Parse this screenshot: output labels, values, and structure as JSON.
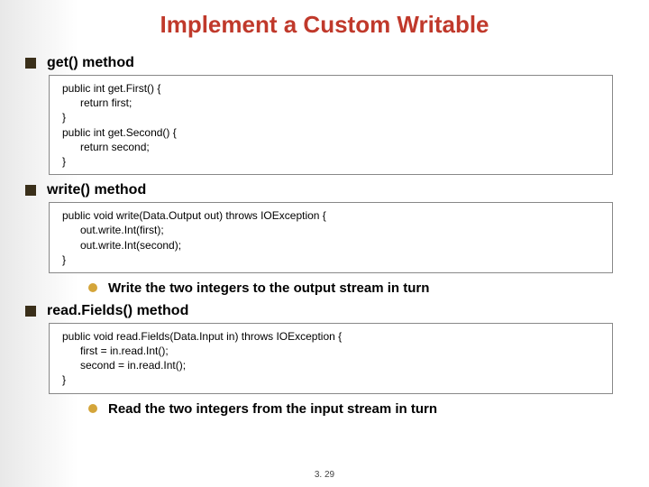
{
  "title": "Implement a Custom Writable",
  "sections": {
    "get": {
      "label": "get() method",
      "code": "public int get.First() {\n      return first;\n}\npublic int get.Second() {\n      return second;\n}"
    },
    "write": {
      "label": "write() method",
      "code": "public void write(Data.Output out) throws IOException {\n      out.write.Int(first);\n      out.write.Int(second);\n}",
      "sub": "Write the two integers to the output stream in turn"
    },
    "readfields": {
      "label": "read.Fields() method",
      "code": "public void read.Fields(Data.Input in) throws IOException {\n      first = in.read.Int();\n      second = in.read.Int();\n}",
      "sub": "Read the two integers from the input stream in turn"
    }
  },
  "footer": "3. 29"
}
